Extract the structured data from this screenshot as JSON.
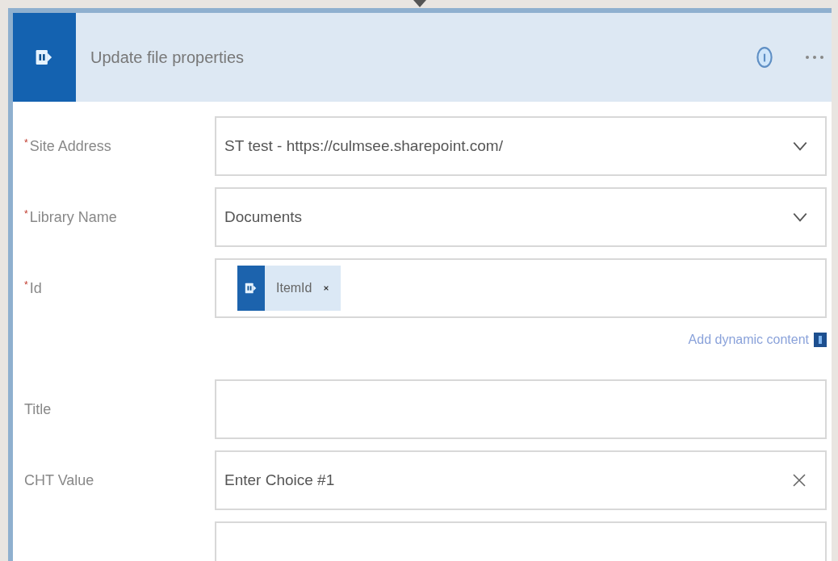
{
  "card": {
    "title": "Update file properties"
  },
  "fields": [
    {
      "label": "Site Address",
      "required_mark": "*",
      "kind": "dropdown",
      "value": "ST test - https://culmsee.sharepoint.com/"
    },
    {
      "label": "Library Name",
      "required_mark": "*",
      "kind": "dropdown",
      "value": "Documents"
    },
    {
      "label": "Id",
      "required_mark": "*",
      "kind": "token",
      "token": "ItemId",
      "link": "Add dynamic content"
    },
    {
      "label": "Title",
      "kind": "text"
    },
    {
      "label": "CHT Value",
      "kind": "clearable",
      "placeholder": "Enter Choice #1"
    },
    {
      "kind": "text"
    }
  ]
}
